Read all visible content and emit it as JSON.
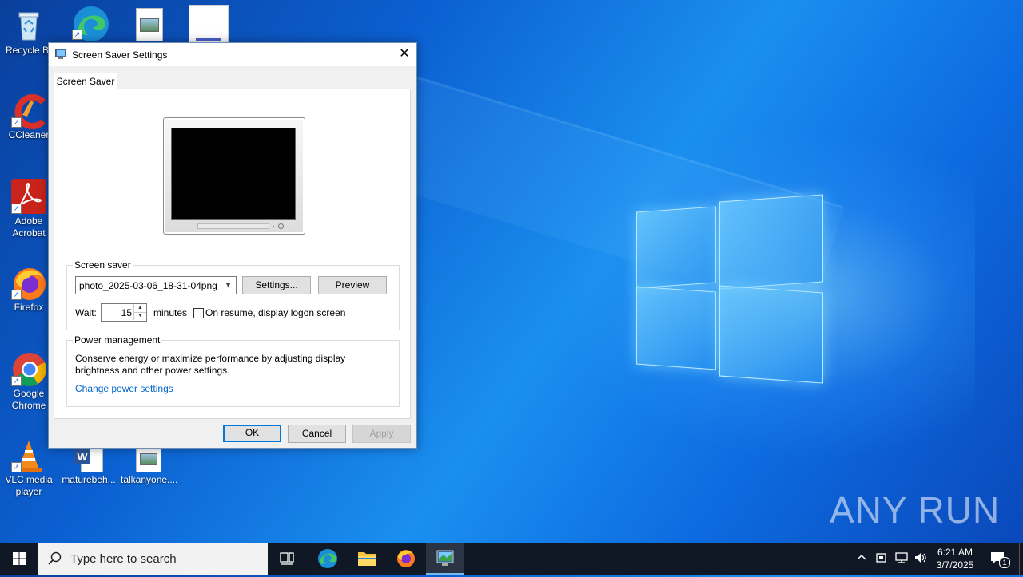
{
  "desktop": {
    "icons": [
      {
        "label": "Recycle Bin"
      },
      {
        "label": "CCleaner"
      },
      {
        "label": "Adobe Acrobat"
      },
      {
        "label": "Firefox"
      },
      {
        "label": "Google Chrome"
      },
      {
        "label": "VLC media player"
      },
      {
        "label": "maturebeh..."
      },
      {
        "label": "talkanyone...."
      }
    ],
    "watermark": "ANY RUN"
  },
  "dialog": {
    "title": "Screen Saver Settings",
    "close_glyph": "✕",
    "tab_label": "Screen Saver",
    "screen_saver": {
      "legend": "Screen saver",
      "selected": "photo_2025-03-06_18-31-04png",
      "settings_label": "Settings...",
      "preview_label": "Preview",
      "wait_label": "Wait:",
      "wait_value": "15",
      "minutes_label": "minutes",
      "logon_label": "On resume, display logon screen",
      "logon_checked": false
    },
    "power": {
      "legend": "Power management",
      "description": "Conserve energy or maximize performance by adjusting display brightness and other power settings.",
      "link": "Change power settings"
    },
    "buttons": {
      "ok": "OK",
      "cancel": "Cancel",
      "apply": "Apply"
    }
  },
  "taskbar": {
    "search_placeholder": "Type here to search",
    "time": "6:21 AM",
    "date": "3/7/2025",
    "notification_count": "1"
  },
  "colors": {
    "accent": "#0078d7",
    "taskbar": "#101826",
    "link": "#0066cc"
  }
}
